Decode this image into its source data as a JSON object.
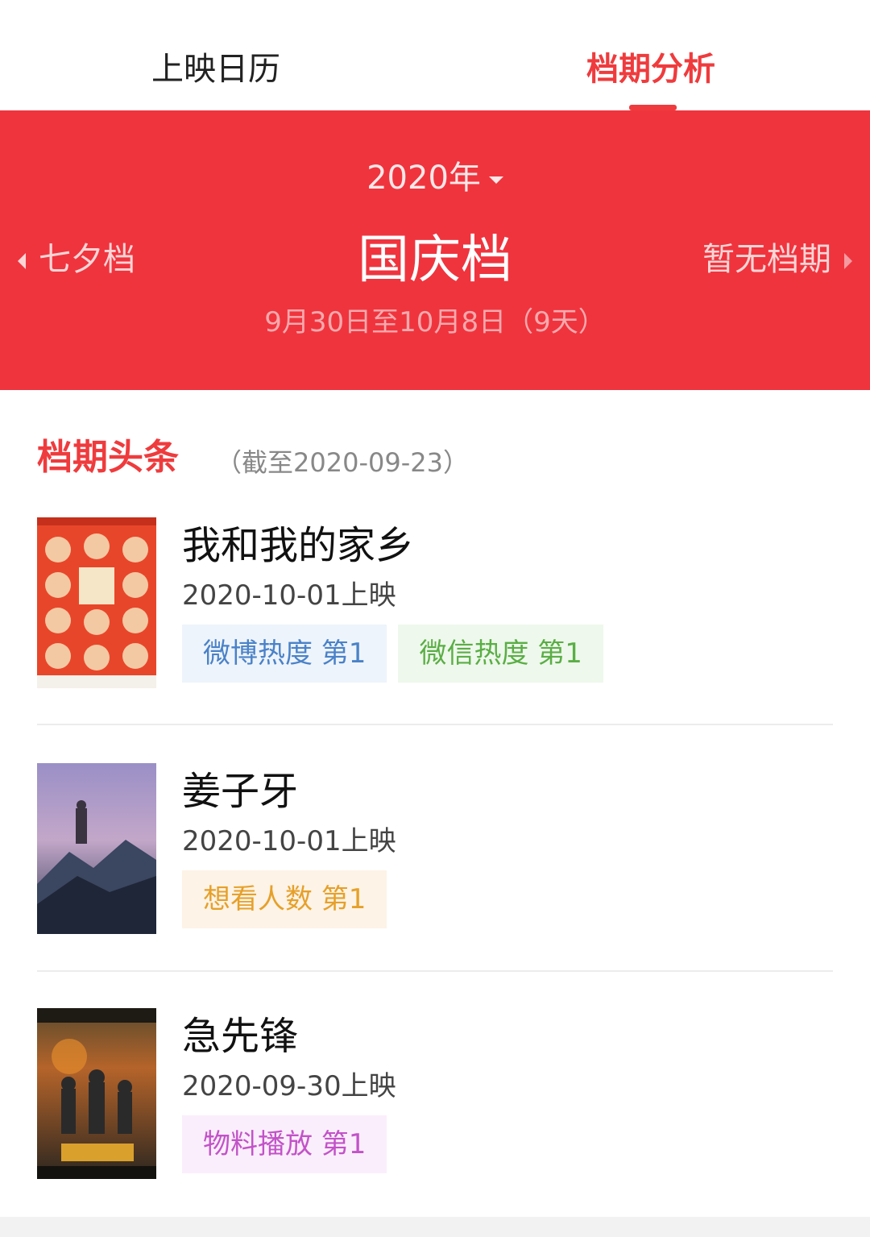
{
  "tabs": {
    "calendar": "上映日历",
    "analysis": "档期分析"
  },
  "banner": {
    "year": "2020年",
    "prev_season": "七夕档",
    "current_season": "国庆档",
    "next_season": "暂无档期",
    "date_range": "9月30日至10月8日（9天）"
  },
  "section": {
    "title": "档期头条",
    "note": "（截至2020-09-23）"
  },
  "movies": [
    {
      "title": "我和我的家乡",
      "release": "2020-10-01上映",
      "tags": [
        {
          "label": "微博热度 第1",
          "color": "#4a82c8"
        },
        {
          "label": "微信热度 第1",
          "color": "#5aae45"
        }
      ]
    },
    {
      "title": "姜子牙",
      "release": "2020-10-01上映",
      "tags": [
        {
          "label": "想看人数 第1",
          "color": "#e6a02a"
        }
      ]
    },
    {
      "title": "急先锋",
      "release": "2020-09-30上映",
      "tags": [
        {
          "label": "物料播放 第1",
          "color": "#c253c8"
        }
      ]
    }
  ],
  "colors": {
    "accent": "#ef3b3d",
    "banner": "#ef343e"
  }
}
